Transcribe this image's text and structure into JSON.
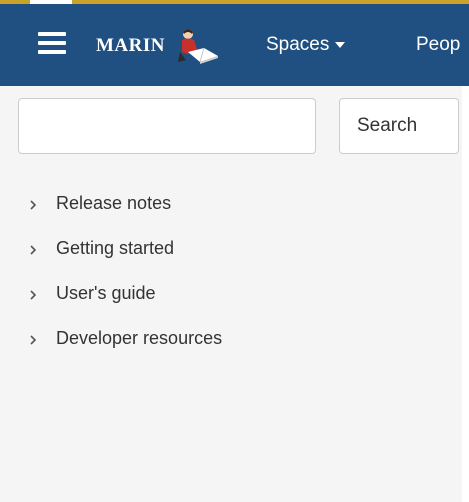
{
  "header": {
    "logo_text": "MARIN",
    "menu_icon": "hamburger-menu-icon",
    "nav": {
      "spaces_label": "Spaces",
      "people_label": "Peop"
    },
    "colors": {
      "navbar": "#205081",
      "accent": "#c9a227"
    }
  },
  "search": {
    "value": "",
    "placeholder": "",
    "button_label": "Search"
  },
  "tree": {
    "items": [
      {
        "label": "Release notes",
        "icon": "chevron-right-icon"
      },
      {
        "label": "Getting started",
        "icon": "chevron-right-icon"
      },
      {
        "label": "User's guide",
        "icon": "chevron-right-icon"
      },
      {
        "label": "Developer resources",
        "icon": "chevron-right-icon"
      }
    ]
  }
}
